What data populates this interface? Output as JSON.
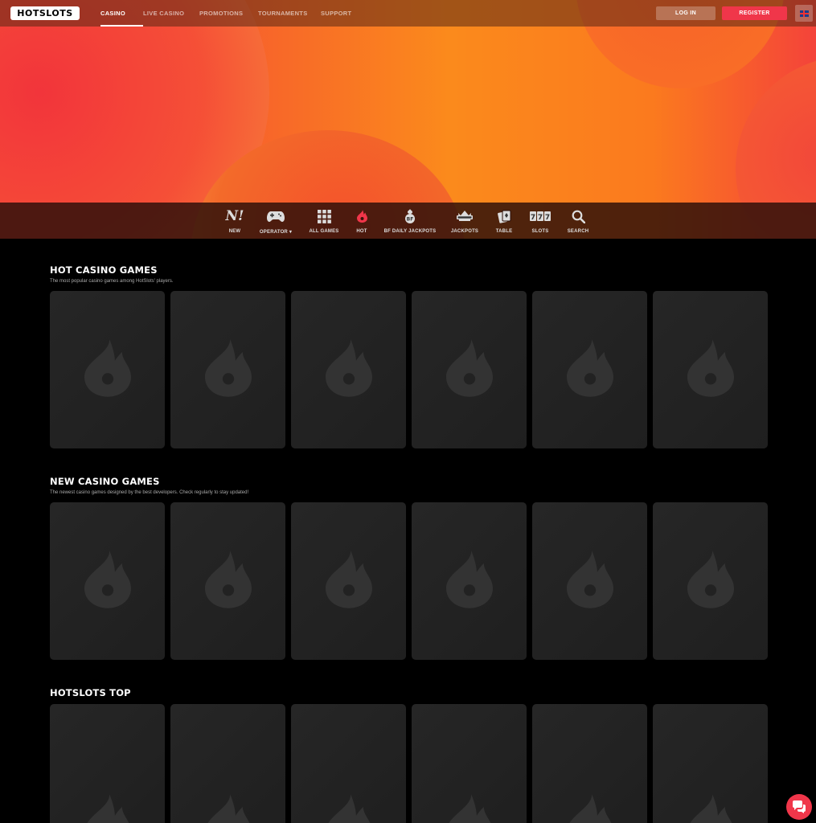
{
  "header": {
    "logo_text": "HOTSLOTS",
    "nav": [
      {
        "label": "CASINO",
        "active": true
      },
      {
        "label": "LIVE CASINO",
        "active": false
      },
      {
        "label": "PROMOTIONS",
        "active": false
      },
      {
        "label": "TOURNAMENTS",
        "active": false
      },
      {
        "label": "SUPPORT",
        "active": false
      }
    ],
    "login_label": "LOG IN",
    "register_label": "REGISTER",
    "language_icon": "uk-flag-icon"
  },
  "categories": [
    {
      "label": "NEW",
      "icon": "new-icon"
    },
    {
      "label": "OPERATOR ▾",
      "icon": "gamepad-icon"
    },
    {
      "label": "ALL GAMES",
      "icon": "grid-icon"
    },
    {
      "label": "HOT",
      "icon": "flame-icon"
    },
    {
      "label": "BF DAILY JACKPOTS",
      "icon": "bf-jackpot-icon"
    },
    {
      "label": "JACKPOTS",
      "icon": "jackpot-icon"
    },
    {
      "label": "TABLE",
      "icon": "cards-icon"
    },
    {
      "label": "SLOTS",
      "icon": "slots-777-icon"
    },
    {
      "label": "SEARCH",
      "icon": "search-icon"
    }
  ],
  "sections": [
    {
      "title": "HOT CASINO GAMES",
      "subtitle": "The most popular casino games among HotSlots' players."
    },
    {
      "title": "NEW CASINO GAMES",
      "subtitle": "The newest casino games designed by the best developers. Check regularly to stay updated!"
    },
    {
      "title": "HOTSLOTS TOP",
      "subtitle": ""
    }
  ],
  "colors": {
    "accent": "#f0364a",
    "background": "#000000",
    "card": "#242424"
  },
  "chat_icon": "chat-bubble-icon"
}
